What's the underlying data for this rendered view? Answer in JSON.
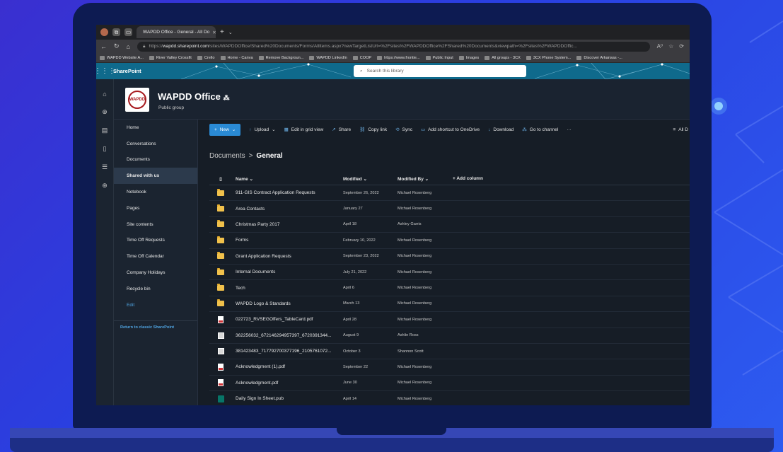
{
  "browser": {
    "tab_title": "WAPDD Office - General - All Do",
    "new_tab": "+",
    "url_prefix": "https://",
    "url_host": "wapdd.sharepoint.com",
    "url_rest": "/sites/WAPDDOffice/Shared%20Documents/Forms/AllItems.aspx?newTargetListUrl=%2Fsites%2FWAPDDOffice%2FShared%20Documents&viewpath=%2Fsites%2FWAPDDOffic..."
  },
  "bookmarks": [
    "WAPDD Website A...",
    "River Valley Crossfit",
    "Crello",
    "Home - Canva",
    "Remove Backgroun...",
    "WAPDD LinkedIn",
    "COOP",
    "https://www.frontie...",
    "Public Input",
    "Images",
    "All groups - 3CX",
    "3CX Phone System...",
    "Discover Arkansas -..."
  ],
  "suite": {
    "app_name": "SharePoint",
    "search_placeholder": "Search this library"
  },
  "site": {
    "logo_text": "WAPDD",
    "title": "WAPDD Office",
    "subtitle": "Public group"
  },
  "nav": {
    "items": [
      "Home",
      "Conversations",
      "Documents",
      "Shared with us",
      "Notebook",
      "Pages",
      "Site contents",
      "Time Off Requests",
      "Time Off Calendar",
      "Company Holidays",
      "Recycle bin"
    ],
    "active_index": 3,
    "edit": "Edit",
    "classic_link": "Return to classic SharePoint"
  },
  "commands": {
    "new": "New",
    "upload": "Upload",
    "grid": "Edit in grid view",
    "share": "Share",
    "copy_link": "Copy link",
    "sync": "Sync",
    "shortcut": "Add shortcut to OneDrive",
    "download": "Download",
    "channel": "Go to channel",
    "more": "···",
    "view": "All D"
  },
  "breadcrumb": {
    "root": "Documents",
    "sep": ">",
    "current": "General"
  },
  "columns": {
    "name": "Name",
    "modified": "Modified",
    "modified_by": "Modified By",
    "add": "+ Add column"
  },
  "files": [
    {
      "type": "folder",
      "name": "911-GIS Contract Application Requests",
      "modified": "September 26, 2022",
      "by": "Michael Rosenberg"
    },
    {
      "type": "folder",
      "name": "Area Contacts",
      "modified": "January 27",
      "by": "Michael Rosenberg"
    },
    {
      "type": "folder",
      "name": "Christmas Party 2017",
      "modified": "April 18",
      "by": "Ashley Garris"
    },
    {
      "type": "folder",
      "name": "Forms",
      "modified": "February 10, 2022",
      "by": "Michael Rosenberg"
    },
    {
      "type": "folder",
      "name": "Grant Application Requests",
      "modified": "September 23, 2022",
      "by": "Michael Rosenberg"
    },
    {
      "type": "folder",
      "name": "Internal Documents",
      "modified": "July 21, 2022",
      "by": "Michael Rosenberg"
    },
    {
      "type": "folder",
      "name": "Tech",
      "modified": "April 6",
      "by": "Michael Rosenberg"
    },
    {
      "type": "folder",
      "name": "WAPDD Logo & Standards",
      "modified": "March 13",
      "by": "Michael Rosenberg"
    },
    {
      "type": "pdf",
      "name": "022723_RVSEGOffers_TableCard.pdf",
      "modified": "April 28",
      "by": "Michael Rosenberg"
    },
    {
      "type": "img",
      "name": "362256032_672146294957397_6720391344...",
      "modified": "August 9",
      "by": "Ashlie Ross"
    },
    {
      "type": "img",
      "name": "381423483_717792700377196_2105761072...",
      "modified": "October 3",
      "by": "Shannon Scott"
    },
    {
      "type": "pdf",
      "name": "Acknowledgment (1).pdf",
      "modified": "September 22",
      "by": "Michael Rosenberg"
    },
    {
      "type": "pdf",
      "name": "Acknowledgment.pdf",
      "modified": "June 30",
      "by": "Michael Rosenberg"
    },
    {
      "type": "pub",
      "name": "Daily Sign In Sheet.pub",
      "modified": "April 14",
      "by": "Michael Rosenberg"
    }
  ],
  "colors": {
    "accent": "#2a8ad4",
    "suite_bar": "#0f6a8c",
    "background": "#2d3fe0"
  }
}
